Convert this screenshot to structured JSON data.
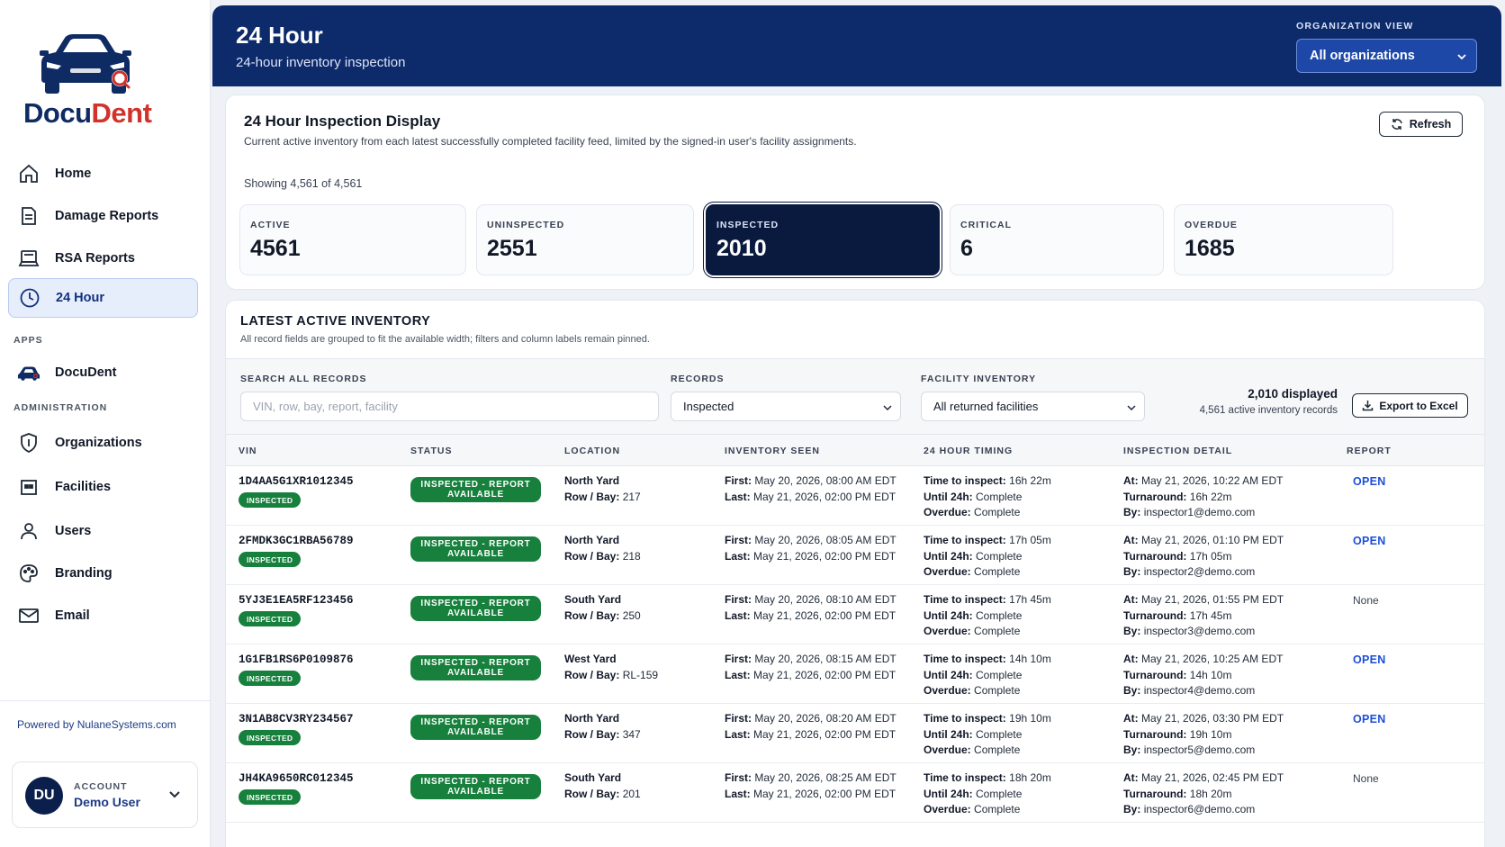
{
  "brand": {
    "name_part1": "Docu",
    "name_part2": "Dent",
    "powered_by": "Powered by NulaneSystems.com"
  },
  "sidebar": {
    "items": [
      {
        "label": "Home",
        "icon": "home-icon"
      },
      {
        "label": "Damage Reports",
        "icon": "document-icon"
      },
      {
        "label": "RSA Reports",
        "icon": "laptop-icon"
      },
      {
        "label": "24 Hour",
        "icon": "clock-icon",
        "active": true
      }
    ],
    "apps_label": "APPS",
    "apps": [
      {
        "label": "DocuDent",
        "icon": "car-icon"
      }
    ],
    "admin_label": "ADMINISTRATION",
    "admin": [
      {
        "label": "Organizations",
        "icon": "shield-icon"
      },
      {
        "label": "Facilities",
        "icon": "facility-icon"
      },
      {
        "label": "Users",
        "icon": "user-icon"
      },
      {
        "label": "Branding",
        "icon": "palette-icon"
      },
      {
        "label": "Email",
        "icon": "mail-icon"
      }
    ]
  },
  "account": {
    "initials": "DU",
    "label": "ACCOUNT",
    "name": "Demo User"
  },
  "header": {
    "title": "24 Hour",
    "subtitle": "24-hour inventory inspection",
    "org_view_label": "ORGANIZATION VIEW",
    "org_view_value": "All organizations"
  },
  "display": {
    "title": "24 Hour Inspection Display",
    "description": "Current active inventory from each latest successfully completed facility feed, limited by the signed-in user's facility assignments.",
    "refresh_label": "Refresh",
    "showing": "Showing 4,561 of 4,561",
    "stats": [
      {
        "label": "ACTIVE",
        "value": "4561"
      },
      {
        "label": "UNINSPECTED",
        "value": "2551"
      },
      {
        "label": "INSPECTED",
        "value": "2010",
        "selected": true
      },
      {
        "label": "CRITICAL",
        "value": "6"
      },
      {
        "label": "OVERDUE",
        "value": "1685"
      }
    ]
  },
  "inventory": {
    "title": "LATEST ACTIVE INVENTORY",
    "description": "All record fields are grouped to fit the available width; filters and column labels remain pinned.",
    "search_label": "SEARCH ALL RECORDS",
    "search_placeholder": "VIN, row, bay, report, facility",
    "records_label": "RECORDS",
    "records_value": "Inspected",
    "facility_label": "FACILITY INVENTORY",
    "facility_value": "All returned facilities",
    "displayed": "2,010 displayed",
    "displayed_sub": "4,561 active inventory records",
    "export_label": "Export to Excel",
    "columns": [
      "VIN",
      "STATUS",
      "LOCATION",
      "INVENTORY SEEN",
      "24 HOUR TIMING",
      "INSPECTION DETAIL",
      "REPORT"
    ],
    "rows": [
      {
        "vin": "1D4AA5G1XR1012345",
        "badge": "INSPECTED",
        "status_l1": "INSPECTED - REPORT",
        "status_l2": "AVAILABLE",
        "yard": "North Yard",
        "row_bay": "217",
        "first": "May 20, 2026, 08:00 AM EDT",
        "last": "May 21, 2026, 02:00 PM EDT",
        "time_to_inspect": "16h 22m",
        "until_24h": "Complete",
        "overdue": "Complete",
        "at": "May 21, 2026, 10:22 AM EDT",
        "turnaround": "16h 22m",
        "by": "inspector1@demo.com",
        "report": "OPEN"
      },
      {
        "vin": "2FMDK3GC1RBA56789",
        "badge": "INSPECTED",
        "status_l1": "INSPECTED - REPORT",
        "status_l2": "AVAILABLE",
        "yard": "North Yard",
        "row_bay": "218",
        "first": "May 20, 2026, 08:05 AM EDT",
        "last": "May 21, 2026, 02:00 PM EDT",
        "time_to_inspect": "17h 05m",
        "until_24h": "Complete",
        "overdue": "Complete",
        "at": "May 21, 2026, 01:10 PM EDT",
        "turnaround": "17h 05m",
        "by": "inspector2@demo.com",
        "report": "OPEN"
      },
      {
        "vin": "5YJ3E1EA5RF123456",
        "badge": "INSPECTED",
        "status_l1": "INSPECTED - REPORT",
        "status_l2": "AVAILABLE",
        "yard": "South Yard",
        "row_bay": "250",
        "first": "May 20, 2026, 08:10 AM EDT",
        "last": "May 21, 2026, 02:00 PM EDT",
        "time_to_inspect": "17h 45m",
        "until_24h": "Complete",
        "overdue": "Complete",
        "at": "May 21, 2026, 01:55 PM EDT",
        "turnaround": "17h 45m",
        "by": "inspector3@demo.com",
        "report": "None"
      },
      {
        "vin": "1G1FB1RS6P0109876",
        "badge": "INSPECTED",
        "status_l1": "INSPECTED - REPORT",
        "status_l2": "AVAILABLE",
        "yard": "West Yard",
        "row_bay": "RL-159",
        "first": "May 20, 2026, 08:15 AM EDT",
        "last": "May 21, 2026, 02:00 PM EDT",
        "time_to_inspect": "14h 10m",
        "until_24h": "Complete",
        "overdue": "Complete",
        "at": "May 21, 2026, 10:25 AM EDT",
        "turnaround": "14h 10m",
        "by": "inspector4@demo.com",
        "report": "OPEN"
      },
      {
        "vin": "3N1AB8CV3RY234567",
        "badge": "INSPECTED",
        "status_l1": "INSPECTED - REPORT",
        "status_l2": "AVAILABLE",
        "yard": "North Yard",
        "row_bay": "347",
        "first": "May 20, 2026, 08:20 AM EDT",
        "last": "May 21, 2026, 02:00 PM EDT",
        "time_to_inspect": "19h 10m",
        "until_24h": "Complete",
        "overdue": "Complete",
        "at": "May 21, 2026, 03:30 PM EDT",
        "turnaround": "19h 10m",
        "by": "inspector5@demo.com",
        "report": "OPEN"
      },
      {
        "vin": "JH4KA9650RC012345",
        "badge": "INSPECTED",
        "status_l1": "INSPECTED - REPORT",
        "status_l2": "AVAILABLE",
        "yard": "South Yard",
        "row_bay": "201",
        "first": "May 20, 2026, 08:25 AM EDT",
        "last": "May 21, 2026, 02:00 PM EDT",
        "time_to_inspect": "18h 20m",
        "until_24h": "Complete",
        "overdue": "Complete",
        "at": "May 21, 2026, 02:45 PM EDT",
        "turnaround": "18h 20m",
        "by": "inspector6@demo.com",
        "report": "None"
      }
    ],
    "field_labels": {
      "row_bay": "Row / Bay:",
      "first": "First:",
      "last": "Last:",
      "time_to_inspect": "Time to inspect:",
      "until_24h": "Until 24h:",
      "overdue": "Overdue:",
      "at": "At:",
      "turnaround": "Turnaround:",
      "by": "By:"
    }
  },
  "colors": {
    "header_bg": "#0d2a6b",
    "accent": "#1d4fd8",
    "success": "#16803c",
    "brand_red": "#d1322b",
    "selected_stat": "#0a1a3f"
  }
}
